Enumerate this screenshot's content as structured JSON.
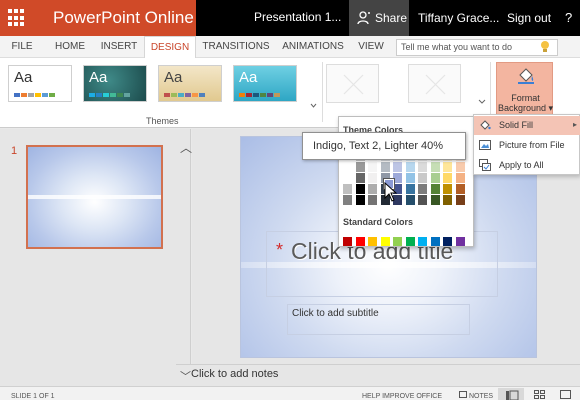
{
  "app": {
    "name": "PowerPoint Online",
    "document_title": "Presentation 1...",
    "user_name": "Tiffany Grace...",
    "sign_out": "Sign out",
    "help": "?"
  },
  "share": {
    "label": "Share"
  },
  "ribbon_tabs": [
    "FILE",
    "HOME",
    "INSERT",
    "DESIGN",
    "TRANSITIONS",
    "ANIMATIONS",
    "VIEW"
  ],
  "active_tab": "DESIGN",
  "tell_me": {
    "placeholder": "Tell me what you want to do"
  },
  "themes": {
    "group_label": "Themes",
    "items": [
      {
        "label": "Aa",
        "style": "office",
        "colors": [
          "#4472c4",
          "#ed7d31",
          "#a5a5a5",
          "#ffc000",
          "#5b9bd5",
          "#70ad47"
        ]
      },
      {
        "label": "Aa",
        "style": "teal-dark",
        "colors": [
          "#1cade4",
          "#2683c6",
          "#27ced7",
          "#42ba97",
          "#3e8853",
          "#62a39f"
        ]
      },
      {
        "label": "Aa",
        "style": "tan",
        "colors": [
          "#c0504d",
          "#9bbb59",
          "#4bacc6",
          "#8064a2",
          "#f79646",
          "#4f81bd"
        ]
      },
      {
        "label": "Aa",
        "style": "aqua",
        "colors": [
          "#f07f09",
          "#9f2936",
          "#1b587c",
          "#4e8542",
          "#604878",
          "#c19859"
        ]
      }
    ]
  },
  "format_background": {
    "label_line1": "Format",
    "label_line2": "Background ▾"
  },
  "color_picker": {
    "theme_colors_label": "Theme Colors",
    "standard_colors_label": "Standard Colors",
    "theme_columns": [
      "#ffffff",
      "#000000",
      "#e7e6e6",
      "#44546a",
      "#5b6fbf",
      "#4a9bd5",
      "#a5a5a5",
      "#70ad47",
      "#ffc000",
      "#ed7d31"
    ],
    "standard_colors": [
      "#c00000",
      "#ff0000",
      "#ffc000",
      "#ffff00",
      "#92d050",
      "#00b050",
      "#00b0f0",
      "#0070c0",
      "#002060",
      "#7030a0"
    ],
    "selected": "Indigo, Text 2, Lighter 40%"
  },
  "tooltip": {
    "text": "Indigo, Text 2, Lighter 40%"
  },
  "menu": {
    "items": [
      {
        "label": "Solid Fill",
        "icon": "paint-bucket-icon",
        "highlighted": true,
        "submenu": true
      },
      {
        "label": "Picture from File",
        "icon": "picture-icon",
        "highlighted": false,
        "submenu": false
      },
      {
        "label": "Apply to All",
        "icon": "apply-all-icon",
        "highlighted": false,
        "submenu": false
      }
    ]
  },
  "slides_pane": {
    "slide_number": "1"
  },
  "slide": {
    "title_placeholder": "Click to add title",
    "subtitle_placeholder": "Click to add subtitle"
  },
  "notes": {
    "placeholder": "Click to add notes"
  },
  "status_bar": {
    "slide_of": "SLIDE 1 OF 1",
    "help_improve": "HELP IMPROVE OFFICE",
    "notes": "NOTES"
  }
}
